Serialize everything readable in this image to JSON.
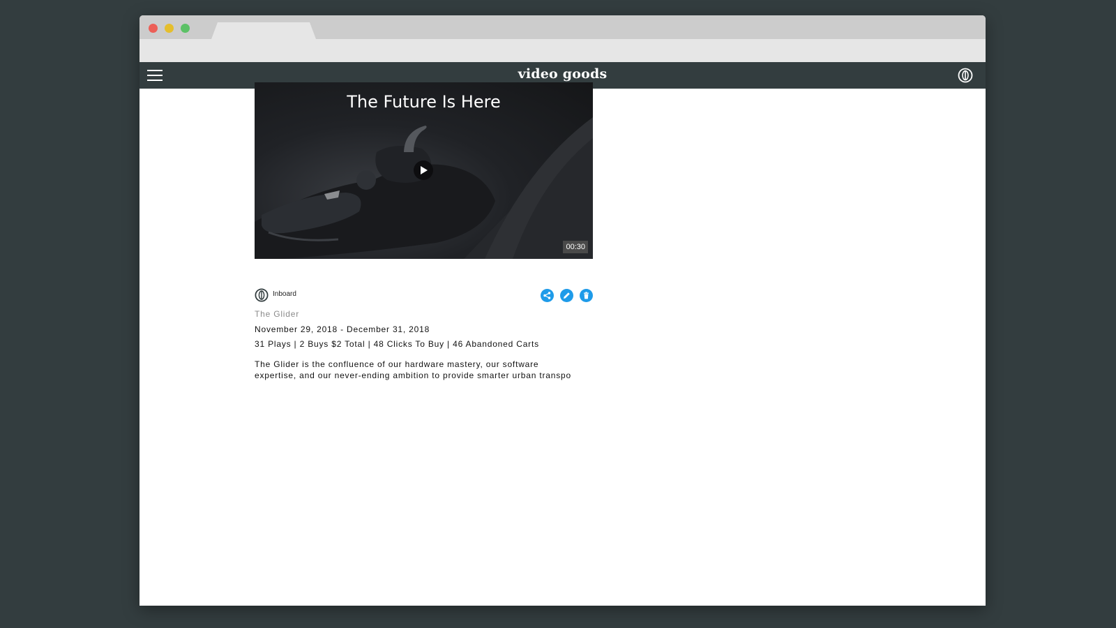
{
  "navbar": {
    "logo": "video goods"
  },
  "video": {
    "title": "The Future Is Here",
    "duration": "00:30"
  },
  "campaign": {
    "brand": "Inboard",
    "product_name": "The Glider",
    "date_range": "November 29, 2018 - December 31, 2018",
    "stats": "31 Plays | 2 Buys $2 Total | 48 Clicks To Buy | 46 Abandoned Carts",
    "description": "The Glider is the confluence of our hardware mastery, our software expertise, and our never-ending ambition to provide smarter urban transpo"
  },
  "icons": {
    "menu": "hamburger-menu-icon",
    "profile": "inboard-logo-icon",
    "play": "play-icon",
    "share": "share-icon",
    "edit": "pencil-icon",
    "delete": "trash-icon"
  },
  "colors": {
    "navbar": "#333d3f",
    "accent": "#1e9be9",
    "background": "#333d3f"
  }
}
